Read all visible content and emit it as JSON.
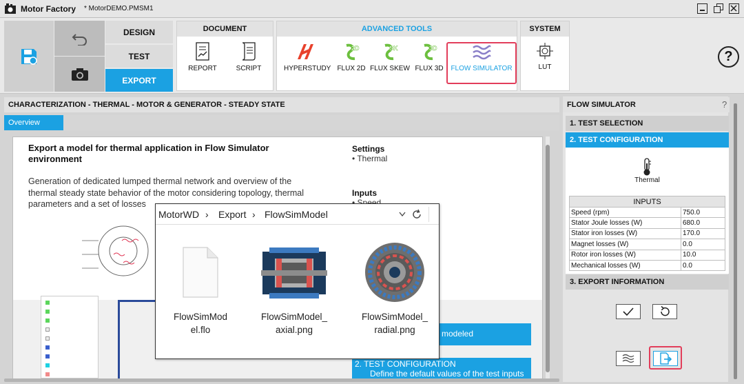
{
  "titlebar": {
    "app_name": "Motor Factory",
    "file_name": "* MotorDEMO.PMSM1"
  },
  "ribbon": {
    "nav": {
      "design": "DESIGN",
      "test": "TEST",
      "export": "EXPORT"
    },
    "document": {
      "label": "DOCUMENT",
      "report": "REPORT",
      "script": "SCRIPT"
    },
    "advanced": {
      "label": "ADVANCED TOOLS",
      "hyperstudy": "HYPERSTUDY",
      "flux2d": "FLUX 2D",
      "fluxskew": "FLUX SKEW",
      "flux3d": "FLUX 3D",
      "flowsim": "FLOW SIMULATOR"
    },
    "system": {
      "label": "SYSTEM",
      "lut": "LUT"
    },
    "help": "?"
  },
  "main": {
    "header": "CHARACTERIZATION - THERMAL - MOTOR & GENERATOR - STEADY STATE",
    "tab": "Overview",
    "doc": {
      "title": "Export a model for thermal application in Flow Simulator environment",
      "text": "Generation of dedicated lumped thermal network and overview of the thermal steady state behavior of the motor considering topology, thermal parameters and a set of losses",
      "settings_h": "Settings",
      "settings_v": "• Thermal",
      "inputs_h": "Inputs",
      "inputs_v": "• Speed",
      "band1": "modeled",
      "band2a": "2. TEST CONFIGURATION",
      "band2b": "Define the default values of the test inputs"
    }
  },
  "explorer": {
    "crumb1": "MotorWD",
    "crumb2": "Export",
    "crumb3": "FlowSimModel",
    "file1": "FlowSimModel.flo",
    "file2": "FlowSimModel_axial.png",
    "file3": "FlowSimModel_radial.png"
  },
  "side": {
    "title": "FLOW SIMULATOR",
    "help": "?",
    "step1": "1. TEST SELECTION",
    "step2": "2. TEST CONFIGURATION",
    "thermal": "Thermal",
    "inputs_title": "INPUTS",
    "rows": [
      {
        "name": "Speed (rpm)",
        "value": "750.0"
      },
      {
        "name": "Stator Joule losses (W)",
        "value": "680.0"
      },
      {
        "name": "Stator iron losses (W)",
        "value": "170.0"
      },
      {
        "name": "Magnet losses (W)",
        "value": "0.0"
      },
      {
        "name": "Rotor iron losses (W)",
        "value": "10.0"
      },
      {
        "name": "Mechanical losses (W)",
        "value": "0.0"
      }
    ],
    "step3": "3. EXPORT INFORMATION"
  },
  "colors": {
    "accent": "#1ba1e2",
    "highlight": "#e23d5a"
  }
}
